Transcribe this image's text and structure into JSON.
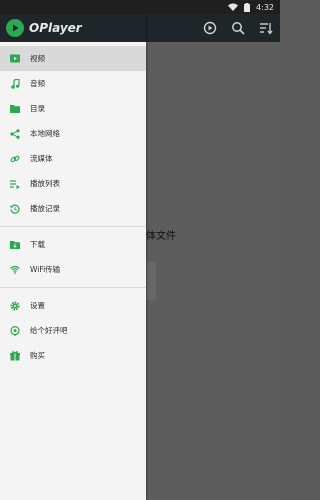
{
  "status_bar": {
    "time": "4:32"
  },
  "app": {
    "name": "OPlayer",
    "peek_text": "体文件"
  },
  "colors": {
    "accent": "#2aa852",
    "toolbar": "#1f262a"
  },
  "menu": {
    "group1": [
      {
        "label": "视频",
        "icon": "video-icon",
        "active": true
      },
      {
        "label": "音频",
        "icon": "music-note-icon"
      },
      {
        "label": "目录",
        "icon": "folder-icon"
      },
      {
        "label": "本地网络",
        "icon": "share-icon"
      },
      {
        "label": "流媒体",
        "icon": "link-icon"
      },
      {
        "label": "播放列表",
        "icon": "playlist-icon"
      },
      {
        "label": "播放记录",
        "icon": "history-icon"
      }
    ],
    "group2": [
      {
        "label": "下载",
        "icon": "download-folder-icon"
      },
      {
        "label": "WiFi传输",
        "icon": "wifi-icon"
      }
    ],
    "group3": [
      {
        "label": "设置",
        "icon": "gear-icon"
      },
      {
        "label": "给个好评吧",
        "icon": "rate-icon"
      },
      {
        "label": "购买",
        "icon": "gift-icon"
      }
    ]
  }
}
